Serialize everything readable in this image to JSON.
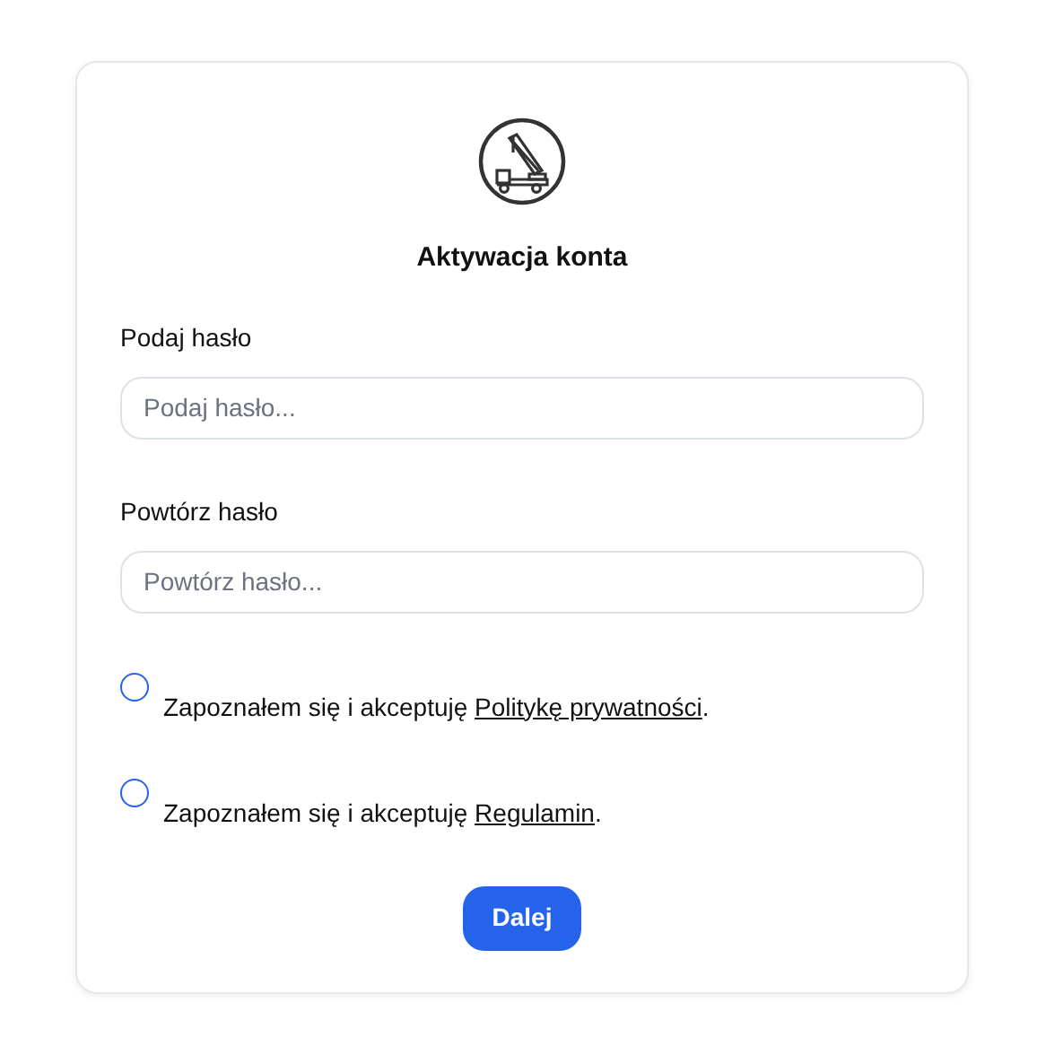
{
  "title": "Aktywacja konta",
  "fields": [
    {
      "label": "Podaj hasło",
      "placeholder": "Podaj hasło..."
    },
    {
      "label": "Powtórz hasło",
      "placeholder": "Powtórz hasło..."
    }
  ],
  "consents": [
    {
      "text": "Zapoznałem się i akceptuję ",
      "link": "Politykę prywatności",
      "suffix": ".",
      "checked": false
    },
    {
      "text": "Zapoznałem się i akceptuję ",
      "link": "Regulamin",
      "suffix": ".",
      "checked": false
    }
  ],
  "button": "Dalej"
}
